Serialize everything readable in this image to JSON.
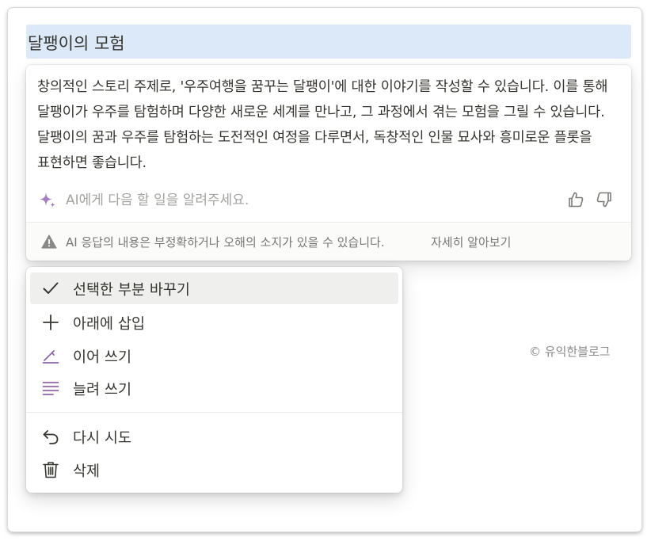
{
  "page": {
    "title": "달팽이의 모험"
  },
  "ai_panel": {
    "response_text": "창의적인 스토리 주제로, '우주여행을 꿈꾸는 달팽이'에 대한 이야기를 작성할 수 있습니다. 이를 통해 달팽이가 우주를 탐험하며 다양한 새로운 세계를 만나고, 그 과정에서 겪는 모험을 그릴 수 있습니다. 달팽이의 꿈과 우주를 탐험하는 도전적인 여정을 다루면서, 독창적인 인물 묘사와 흥미로운 플롯을 표현하면 좋습니다.",
    "ask_placeholder": "AI에게 다음 할 일을 알려주세요.",
    "ask_value": "",
    "warning_text": "AI 응답의 내용은 부정확하거나 오해의 소지가 있을 수 있습니다.",
    "learn_more_label": "자세히 알아보기"
  },
  "menu": {
    "items": [
      {
        "label": "선택한 부분 바꾸기",
        "icon": "check-icon",
        "selected": true
      },
      {
        "label": "아래에 삽입",
        "icon": "plus-icon"
      },
      {
        "label": "이어 쓰기",
        "icon": "pen-icon"
      },
      {
        "label": "늘려 쓰기",
        "icon": "lines-icon"
      },
      {
        "label": "다시 시도",
        "icon": "undo-icon"
      },
      {
        "label": "삭제",
        "icon": "trash-icon"
      }
    ]
  },
  "watermark": "© 유익한블로그",
  "colors": {
    "title_highlight": "#dbe9f8",
    "ai_accent": "#9065b0",
    "text": "#37352f",
    "muted": "#787774",
    "selected_bg": "#efefee"
  }
}
